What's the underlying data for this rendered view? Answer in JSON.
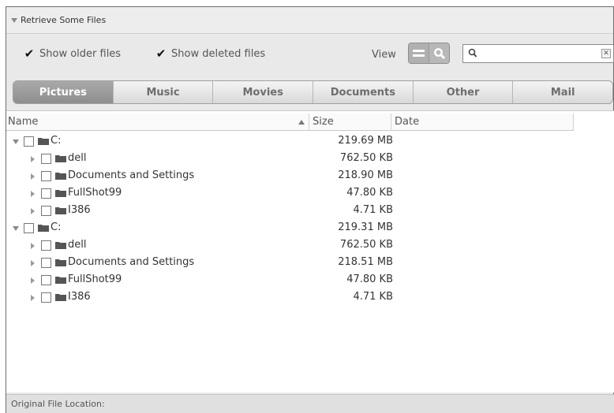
{
  "titlebar": {
    "title": "Retrieve Some Files"
  },
  "options": {
    "show_older_label": "Show older files",
    "show_older_checked": true,
    "show_deleted_label": "Show deleted files",
    "show_deleted_checked": true,
    "view_label": "View",
    "search_value": "",
    "search_placeholder": ""
  },
  "tabs": [
    {
      "label": "Pictures",
      "active": true
    },
    {
      "label": "Music",
      "active": false
    },
    {
      "label": "Movies",
      "active": false
    },
    {
      "label": "Documents",
      "active": false
    },
    {
      "label": "Other",
      "active": false
    },
    {
      "label": "Mail",
      "active": false
    }
  ],
  "columns": {
    "name": "Name",
    "size": "Size",
    "date": "Date"
  },
  "rows": [
    {
      "name": "C:",
      "size": "219.69 MB",
      "level": 0,
      "expanded": true
    },
    {
      "name": "dell",
      "size": "762.50 KB",
      "level": 1,
      "expanded": false
    },
    {
      "name": "Documents and Settings",
      "size": "218.90 MB",
      "level": 1,
      "expanded": false
    },
    {
      "name": "FullShot99",
      "size": "47.80 KB",
      "level": 1,
      "expanded": false
    },
    {
      "name": "I386",
      "size": "4.71 KB",
      "level": 1,
      "expanded": false
    },
    {
      "name": "C:",
      "size": "219.31 MB",
      "level": 0,
      "expanded": true
    },
    {
      "name": "dell",
      "size": "762.50 KB",
      "level": 1,
      "expanded": false
    },
    {
      "name": "Documents and Settings",
      "size": "218.51 MB",
      "level": 1,
      "expanded": false
    },
    {
      "name": "FullShot99",
      "size": "47.80 KB",
      "level": 1,
      "expanded": false
    },
    {
      "name": "I386",
      "size": "4.71 KB",
      "level": 1,
      "expanded": false
    }
  ],
  "footer": {
    "label": "Original File Location:"
  },
  "colors": {
    "active_tab": "#9c9c9c",
    "folder": "#555555",
    "panel": "#e9e9e9"
  }
}
